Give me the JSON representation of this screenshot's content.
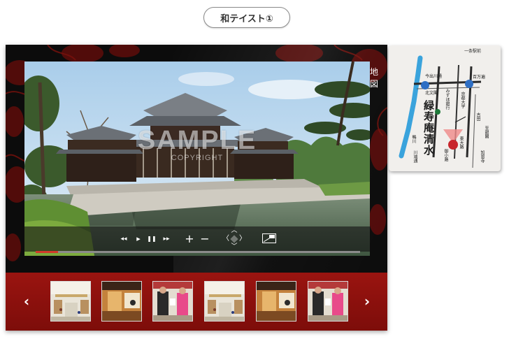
{
  "header": {
    "title": "和テイスト①"
  },
  "side_tab": {
    "label_chars": [
      "地",
      "図"
    ]
  },
  "video": {
    "watermark": "SAMPLE",
    "watermark_sub": "COPYRIGHT",
    "progress": 0.07
  },
  "controls": {
    "rewind": "◂◂",
    "play": "▸",
    "pause": "❚❚",
    "fast_forward": "▸▸",
    "zoom_in": "+",
    "zoom_out": "−",
    "pan_up": "︿",
    "pan_down": "﹀",
    "pan_left": "〈",
    "pan_right": "〉"
  },
  "thumb_nav": {
    "prev": "‹",
    "next": "›"
  },
  "thumbnails": [
    {
      "scene": "mall"
    },
    {
      "scene": "shop"
    },
    {
      "scene": "people"
    },
    {
      "scene": "mall"
    },
    {
      "scene": "shop"
    },
    {
      "scene": "people"
    }
  ],
  "map": {
    "station_top": "一条駅前",
    "street_a": "今出川通",
    "street_b": "百万遍",
    "gate": "北文閣",
    "line": "京都大学",
    "shop_name": "緑寿庵清水",
    "river": "鴨川",
    "road_left": "川端通",
    "road_mid": "御小路",
    "road_right": "東大路",
    "misc_a": "みずほ銀行",
    "misc_b": "吉田",
    "misc_c": "知恩寺",
    "misc_d": "至銀閣"
  },
  "colors": {
    "accent_red": "#9a1410",
    "river_blue": "#3aa3dc",
    "station_blue": "#2f6fc4",
    "shop_red": "#c8262c",
    "landmark_green": "#1f7a3a"
  }
}
